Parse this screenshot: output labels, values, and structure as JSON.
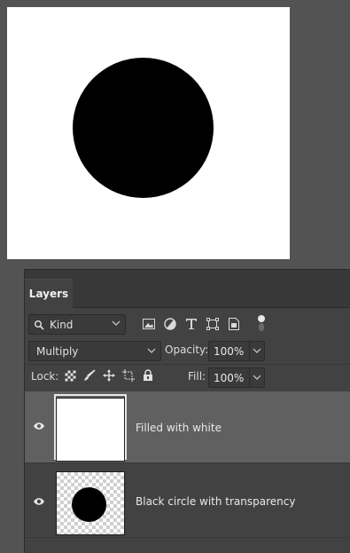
{
  "panel": {
    "tab_label": "Layers"
  },
  "filter": {
    "kind_label": "Kind",
    "icons": [
      "image-filter-icon",
      "adjustment-filter-icon",
      "type-filter-icon",
      "shape-filter-icon",
      "smart-object-filter-icon",
      "filter-toggle-icon"
    ]
  },
  "blend": {
    "mode": "Multiply",
    "opacity_label": "Opacity:",
    "opacity_value": "100%"
  },
  "lock": {
    "label": "Lock:",
    "icons": [
      "lock-transparent-pixels-icon",
      "lock-image-pixels-icon",
      "lock-position-icon",
      "lock-artboard-icon",
      "lock-all-icon"
    ],
    "fill_label": "Fill:",
    "fill_value": "100%"
  },
  "layers": [
    {
      "name": "Filled with white",
      "selected": true,
      "visible": true
    },
    {
      "name": "Black circle with transparency",
      "selected": false,
      "visible": true
    }
  ],
  "colors": {
    "app_bg": "#535353",
    "panel_bg": "#424242",
    "selected_row": "#606060"
  }
}
